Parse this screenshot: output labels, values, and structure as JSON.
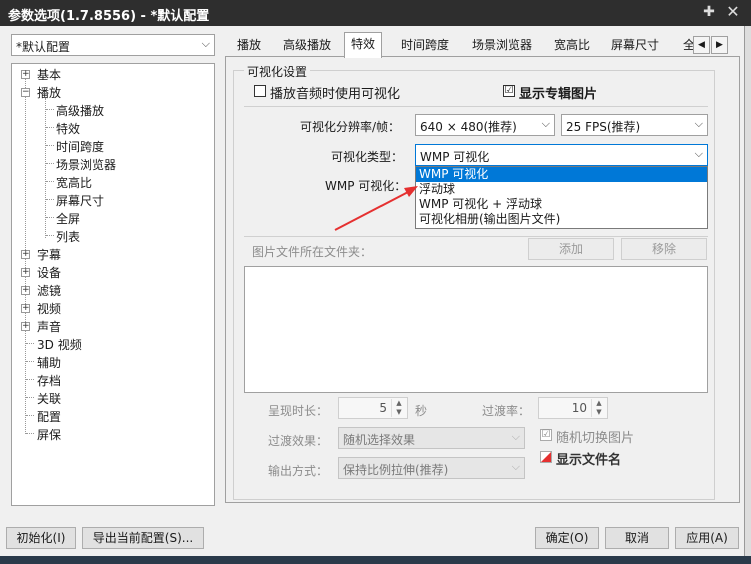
{
  "window": {
    "title": "参数选项(1.7.8556) - *默认配置",
    "pin_icon": "pin-icon",
    "close_icon": "close-icon"
  },
  "profile": {
    "selected": "*默认配置"
  },
  "tree": {
    "items": [
      {
        "label": "基本",
        "expander": "+"
      },
      {
        "label": "播放",
        "expander": "-"
      },
      {
        "label": "高级播放"
      },
      {
        "label": "特效"
      },
      {
        "label": "时间跨度"
      },
      {
        "label": "场景浏览器"
      },
      {
        "label": "宽高比"
      },
      {
        "label": "屏幕尺寸"
      },
      {
        "label": "全屏"
      },
      {
        "label": "列表"
      },
      {
        "label": "字幕",
        "expander": "+"
      },
      {
        "label": "设备",
        "expander": "+"
      },
      {
        "label": "滤镜",
        "expander": "+"
      },
      {
        "label": "视频",
        "expander": "+"
      },
      {
        "label": "声音",
        "expander": "+"
      },
      {
        "label": "3D 视频"
      },
      {
        "label": "辅助"
      },
      {
        "label": "存档"
      },
      {
        "label": "关联"
      },
      {
        "label": "配置"
      },
      {
        "label": "屏保"
      }
    ]
  },
  "tabs": [
    "播放",
    "高级播放",
    "特效",
    "时间跨度",
    "场景浏览器",
    "宽高比",
    "屏幕尺寸",
    "全"
  ],
  "active_tab": "特效",
  "settings": {
    "group_title": "可视化设置",
    "use_vis_when_playing_audio": {
      "label": "播放音频时使用可视化",
      "checked": false
    },
    "show_album_art": {
      "label": "显示专辑图片",
      "checked": true,
      "check_mark": "☑"
    },
    "resolution_label": "可视化分辨率/帧：",
    "resolution_value": "640 × 480(推荐)",
    "fps_value": "25 FPS(推荐)",
    "vis_type_label": "可视化类型：",
    "vis_type_value": "WMP 可视化",
    "wmp_vis_label": "WMP 可视化：",
    "dropdown_options": [
      "WMP 可视化",
      "浮动球",
      "WMP 可视化 + 浮动球",
      "可视化相册(输出图片文件)"
    ],
    "dropdown_selected_index": 0,
    "image_folder_label": "图片文件所在文件夹：",
    "add_button": "添加",
    "remove_button": "移除",
    "duration_label": "呈现时长：",
    "duration_value": "5",
    "duration_unit": "秒",
    "transition_rate_label": "过渡率：",
    "transition_rate_value": "10",
    "transition_effect_label": "过渡效果：",
    "transition_effect_value": "随机选择效果",
    "random_switch": {
      "label": "随机切换图片",
      "checked": true,
      "check_mark": "☑"
    },
    "show_filename": {
      "label": "显示文件名"
    },
    "output_mode_label": "输出方式：",
    "output_mode_value": "保持比例拉伸(推荐)"
  },
  "footer": {
    "init_button": "初始化(I)",
    "export_button": "导出当前配置(S)...",
    "ok_button": "确定(O)",
    "cancel_button": "取消",
    "apply_button": "应用(A)"
  },
  "colors": {
    "titlebar": "#2e2e2e",
    "selection": "#0078d7",
    "annotation_arrow": "#e53030"
  }
}
